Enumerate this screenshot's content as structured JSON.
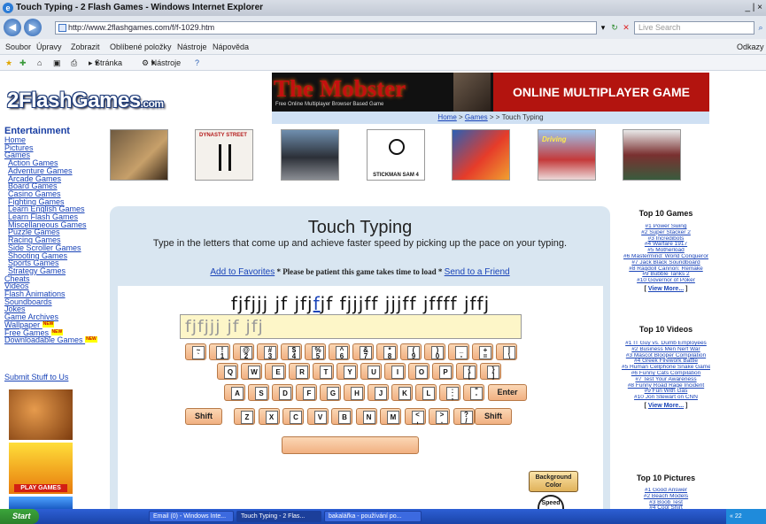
{
  "window": {
    "title": "Touch Typing - 2 Flash Games - Windows Internet Explorer",
    "controls": "_ | ×"
  },
  "address": {
    "url": "http://www.2flashgames.com/f/f-1029.htm",
    "search_placeholder": "Live Search"
  },
  "menu": [
    "Soubor",
    "Úpravy",
    "Zobrazit",
    "Oblíbené položky",
    "Nástroje",
    "Nápověda"
  ],
  "menu_right": "Odkazy",
  "favbar": {
    "page": "Stránka",
    "tools": "Nástroje"
  },
  "site": {
    "logo": "2FlashGames",
    "logo_suffix": ".com"
  },
  "banner": {
    "title": "The Mobster",
    "subtitle": "Free Online Multiplayer Browser Based Game",
    "right": "ONLINE MULTIPLAYER GAME"
  },
  "breadcrumb": {
    "home": "Home",
    "games": "Games",
    "sep1": " > ",
    "sep2": " > > ",
    "current": "Touch Typing"
  },
  "sidebar": {
    "heading": "Entertainment",
    "top_links": [
      "Home",
      "Pictures",
      "Games"
    ],
    "game_links": [
      "Action Games",
      "Adventure Games",
      "Arcade Games",
      "Board Games",
      "Casino Games",
      "Fighting Games",
      "Learn English Games",
      "Learn Flash Games",
      "Miscellaneous Games",
      "Puzzle Games",
      "Racing Games",
      "Side Scroller Games",
      "Shooting Games",
      "Sports Games",
      "Strategy Games"
    ],
    "more_links": [
      "Cheats",
      "Videos",
      "Flash Animations",
      "Soundboards",
      "Jokes",
      "Game Archives"
    ],
    "new_links": [
      "Wallpaper",
      "Free Games",
      "Downloadable Games"
    ],
    "new_badge": "NEW",
    "submit": "Submit Stuff to Us",
    "ad_play": "PLAY GAMES"
  },
  "thumbs": [
    {
      "name": "thumb-1",
      "label": ""
    },
    {
      "name": "thumb-dynasty",
      "label": "DYNASTY STREET"
    },
    {
      "name": "thumb-3",
      "label": ""
    },
    {
      "name": "thumb-stickman",
      "label": "STICKMAN SAM 4"
    },
    {
      "name": "thumb-5",
      "label": ""
    },
    {
      "name": "thumb-driving",
      "label": "Driving"
    },
    {
      "name": "thumb-7",
      "label": ""
    }
  ],
  "game": {
    "title": "Touch Typing",
    "description": "Type in the letters that come up and achieve faster speed by picking up the pace on your typing.",
    "add_favorites": "Add to Favorites",
    "patience": " * Please be patient this game takes time to load * ",
    "send_friend": "Send to a Friend",
    "target_before": "fjfjjj jf jfj",
    "target_cursor": "f",
    "target_after": "jf fjjjff jjjff jffff jffj",
    "typed": "fjfjjj jf jfj",
    "background_button": "Background Color",
    "speed": "Speed"
  },
  "keyboard": {
    "row1": [
      [
        "~",
        "`"
      ],
      [
        "!",
        "1"
      ],
      [
        "@",
        "2"
      ],
      [
        "#",
        "3"
      ],
      [
        "$",
        "4"
      ],
      [
        "%",
        "5"
      ],
      [
        "^",
        "6"
      ],
      [
        "&",
        "7"
      ],
      [
        "*",
        "8"
      ],
      [
        "(",
        "9"
      ],
      [
        ")",
        "0"
      ],
      [
        "_",
        "-"
      ],
      [
        "+",
        "="
      ],
      [
        "|",
        "\\"
      ]
    ],
    "row2": [
      "Q",
      "W",
      "E",
      "R",
      "T",
      "Y",
      "U",
      "I",
      "O",
      "P",
      [
        "{",
        "["
      ],
      [
        "}",
        "]"
      ]
    ],
    "row3": [
      "A",
      "S",
      "D",
      "F",
      "G",
      "H",
      "J",
      "K",
      "L",
      [
        ":",
        ";"
      ],
      [
        "\"",
        "'"
      ]
    ],
    "row3_enter": "Enter",
    "row4": [
      "Z",
      "X",
      "C",
      "V",
      "B",
      "N",
      "M",
      [
        "<",
        ","
      ],
      [
        ">",
        "."
      ],
      [
        "?",
        "/"
      ]
    ],
    "shift": "Shift"
  },
  "right": {
    "games_heading": "Top 10 Games",
    "games": [
      "#1 Power Swing",
      "#2 Super Stacker 2",
      "#3 Incredibots",
      "#4 Warfare 1917",
      "#5 Motherload",
      "#6 Mastermind: World Conqueror",
      "#7 Jack Black Soundboard",
      "#8 Ragdoll Cannon: Remake",
      "#9 Bubble Tanks 2",
      "#10 Governor of Poker"
    ],
    "videos_heading": "Top 10 Videos",
    "videos": [
      "#1 IT Guy vs. Dumb Employees",
      "#2 Business Men Nerf War",
      "#3 Mascot Blooper Compilation",
      "#4 Greek Firework Battle",
      "#5 Human Cellphone Snake Game",
      "#6 Funny Cats Compilation",
      "#7 Test Your Awareness",
      "#8 Funny Road Rage Incident",
      "#9 Fun With Gas",
      "#10 Jon Stewart on CNN"
    ],
    "view_more": "View More...",
    "pictures_heading": "Top 10 Pictures",
    "pictures": [
      "#1 Good Answer",
      "#2 Beach Models",
      "#3 Boob Test",
      "#4 Cool Shirt"
    ]
  },
  "taskbar": {
    "start": "Start",
    "tasks": [
      "Email (0) - Windows Inte...",
      "Touch Typing - 2 Flas...",
      "bakalářka - používání po..."
    ],
    "tray": "« 22"
  }
}
